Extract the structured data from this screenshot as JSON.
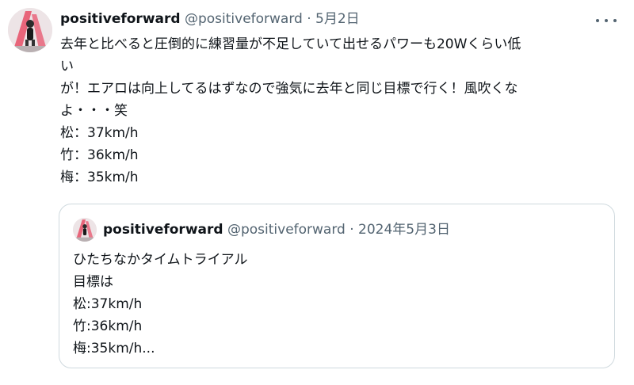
{
  "tweet": {
    "author_name": "positiveforward",
    "author_handle": "@positiveforward",
    "separator": "·",
    "date": "5月2日",
    "lines": [
      "去年と比べると圧倒的に練習量が不足していて出せるパワーも20Wくらい低",
      "い",
      "が！エアロは向上してるはずなので強気に去年と同じ目標で行く！風吹くな",
      "よ・・・笑",
      "松：37km/h",
      "竹：36km/h",
      "梅：35km/h"
    ]
  },
  "quoted_tweet": {
    "author_name": "positiveforward",
    "author_handle": "@positiveforward",
    "separator": "·",
    "date": "2024年5月3日",
    "lines": [
      "ひたちなかタイムトライアル",
      "目標は",
      "松:37km/h",
      "竹:36km/h",
      "梅:35km/h..."
    ]
  },
  "icons": {
    "avatar": "profile-photo",
    "more": "more-horizontal-icon"
  },
  "colors": {
    "text": "#0f1419",
    "secondary": "#536471",
    "border": "#cfd9de",
    "avatar_accent": "#e8657a"
  }
}
